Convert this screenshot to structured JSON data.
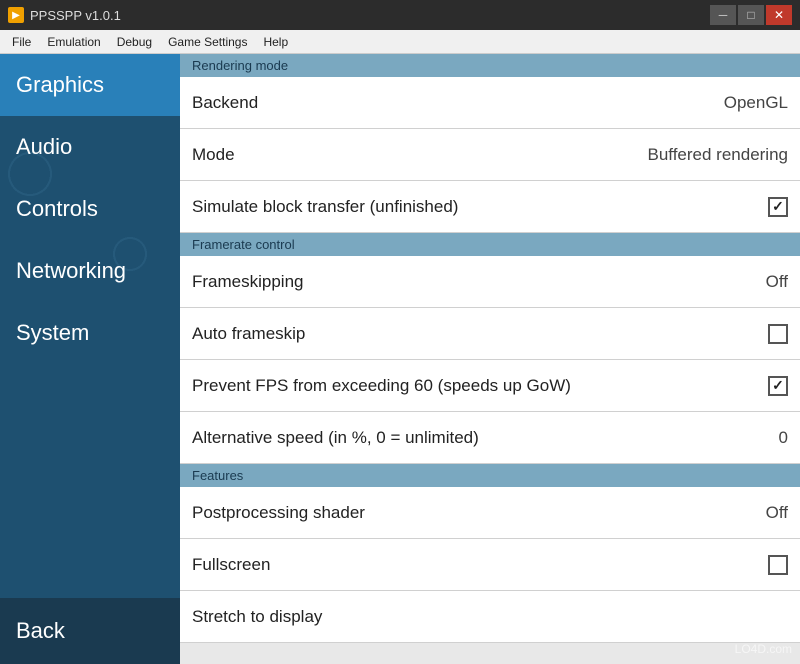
{
  "titlebar": {
    "title": "PPSSPP v1.0.1",
    "icon": "▶",
    "minimize": "─",
    "maximize": "□",
    "close": "✕"
  },
  "menubar": {
    "items": [
      "File",
      "Emulation",
      "Debug",
      "Game Settings",
      "Help"
    ]
  },
  "sidebar": {
    "items": [
      {
        "label": "Graphics",
        "active": true
      },
      {
        "label": "Audio",
        "active": false
      },
      {
        "label": "Controls",
        "active": false
      },
      {
        "label": "Networking",
        "active": false
      },
      {
        "label": "System",
        "active": false
      }
    ],
    "back_label": "Back"
  },
  "sections": [
    {
      "header": "Rendering mode",
      "settings": [
        {
          "label": "Backend",
          "value": "OpenGL",
          "type": "value"
        },
        {
          "label": "Mode",
          "value": "Buffered rendering",
          "type": "value"
        },
        {
          "label": "Simulate block transfer (unfinished)",
          "value": "",
          "type": "checkbox",
          "checked": true
        }
      ]
    },
    {
      "header": "Framerate control",
      "settings": [
        {
          "label": "Frameskipping",
          "value": "Off",
          "type": "value"
        },
        {
          "label": "Auto frameskip",
          "value": "",
          "type": "checkbox",
          "checked": false
        },
        {
          "label": "Prevent FPS from exceeding 60 (speeds up GoW)",
          "value": "",
          "type": "checkbox",
          "checked": true
        },
        {
          "label": "Alternative speed (in %, 0 = unlimited)",
          "value": "0",
          "type": "value"
        }
      ]
    },
    {
      "header": "Features",
      "settings": [
        {
          "label": "Postprocessing shader",
          "value": "Off",
          "type": "value"
        },
        {
          "label": "Fullscreen",
          "value": "",
          "type": "checkbox",
          "checked": false
        },
        {
          "label": "Stretch to display",
          "value": "",
          "type": "partial"
        }
      ]
    }
  ],
  "watermark": "LO4D.com"
}
